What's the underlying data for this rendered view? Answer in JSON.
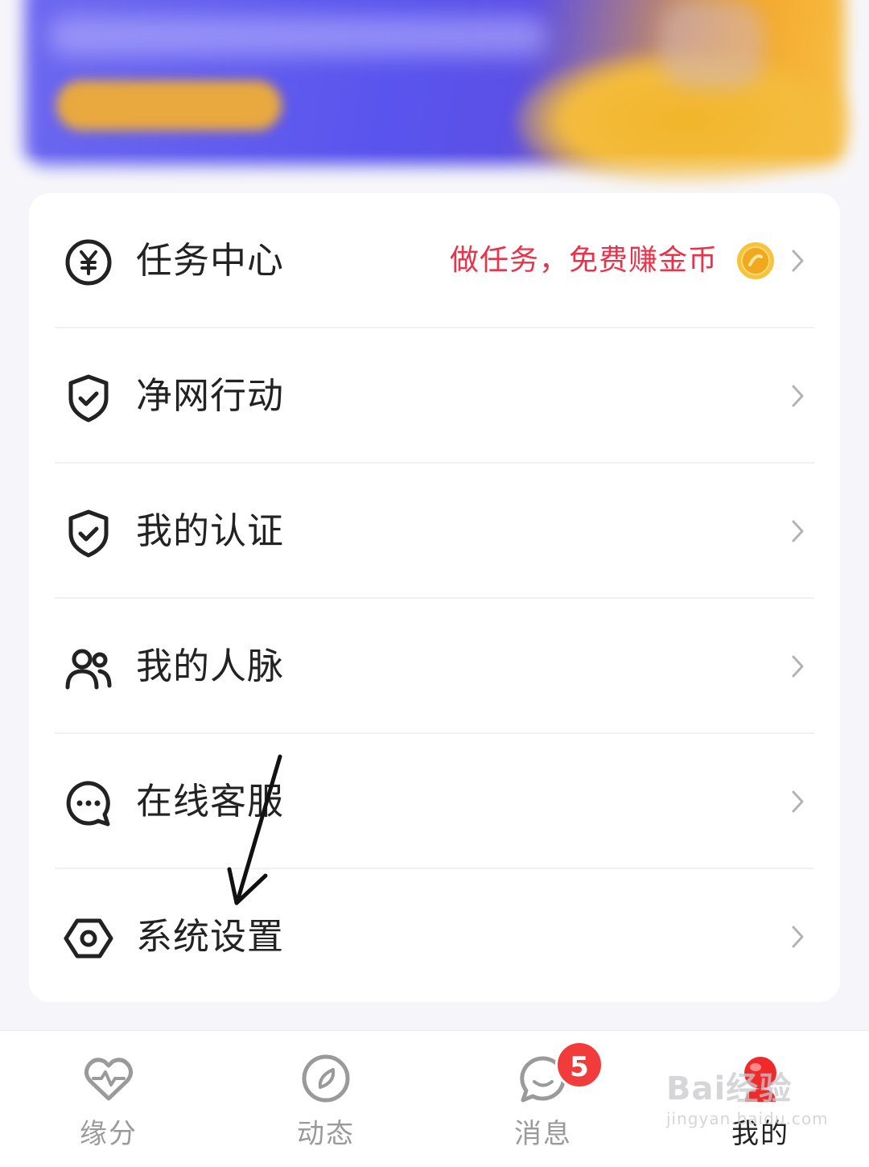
{
  "menu": {
    "items": [
      {
        "id": "task-center",
        "label": "任务中心",
        "icon": "yen-circle-icon",
        "extra_text": "做任务，免费赚金币",
        "extra_icon": "gold-coin-icon"
      },
      {
        "id": "clean-net",
        "label": "净网行动",
        "icon": "shield-check-icon"
      },
      {
        "id": "my-certification",
        "label": "我的认证",
        "icon": "shield-check-icon"
      },
      {
        "id": "my-connections",
        "label": "我的人脉",
        "icon": "people-icon"
      },
      {
        "id": "online-service",
        "label": "在线客服",
        "icon": "chat-bubble-icon"
      },
      {
        "id": "system-settings",
        "label": "系统设置",
        "icon": "hexagon-settings-icon"
      }
    ]
  },
  "tabbar": {
    "tabs": [
      {
        "label": "缘分",
        "icon": "heart-pulse-icon",
        "active": false
      },
      {
        "label": "动态",
        "icon": "compass-icon",
        "active": false
      },
      {
        "label": "消息",
        "icon": "chat-icon",
        "active": false,
        "badge": "5"
      },
      {
        "label": "我的",
        "icon": "profile-icon",
        "active": true
      }
    ]
  },
  "watermark": {
    "main": "Bai经验",
    "sub": "jingyan.baidu.com"
  },
  "colors": {
    "promo_red": "#e8334a",
    "badge_red": "#f23c3c",
    "banner_blue": "#5a54ee",
    "banner_orange": "#f3a62a"
  }
}
